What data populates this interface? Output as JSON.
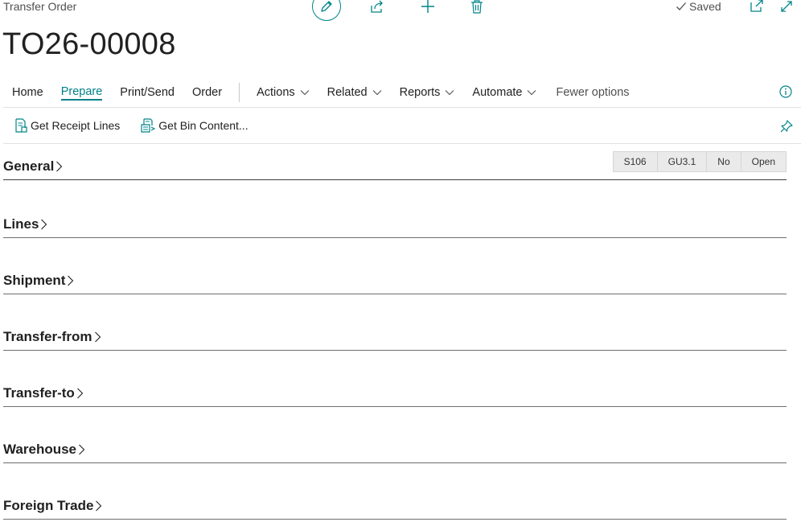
{
  "header": {
    "page_type": "Transfer Order",
    "title": "TO26-00008",
    "status": "Saved"
  },
  "menu": {
    "items": [
      {
        "label": "Home"
      },
      {
        "label": "Prepare"
      },
      {
        "label": "Print/Send"
      },
      {
        "label": "Order"
      },
      {
        "label": "Actions"
      },
      {
        "label": "Related"
      },
      {
        "label": "Reports"
      },
      {
        "label": "Automate"
      },
      {
        "label": "Fewer options"
      }
    ]
  },
  "actions": {
    "get_receipt_lines": "Get Receipt Lines",
    "get_bin_content": "Get Bin Content..."
  },
  "sections": {
    "general": "General",
    "lines": "Lines",
    "shipment": "Shipment",
    "transfer_from": "Transfer-from",
    "transfer_to": "Transfer-to",
    "warehouse": "Warehouse",
    "foreign_trade": "Foreign Trade"
  },
  "general_badges": [
    "S106",
    "GU3.1",
    "No",
    "Open"
  ],
  "colors": {
    "accent": "#00808a",
    "divider": "#e1e1e1"
  },
  "icons": {
    "edit": "pencil-icon",
    "share": "share-icon",
    "new": "plus-icon",
    "delete": "trash-icon",
    "saved": "checkmark-icon",
    "open_new_window": "open-new-window-icon",
    "expand": "expand-icon",
    "info": "info-icon",
    "pin": "pin-icon"
  }
}
